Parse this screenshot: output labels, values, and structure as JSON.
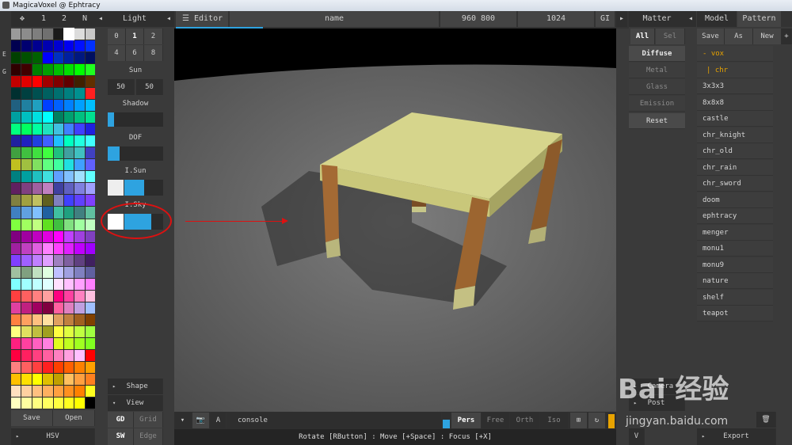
{
  "window": {
    "title": "MagicaVoxel @ Ephtracy"
  },
  "left_toolbar": {
    "tab1": "1",
    "tab2": "2",
    "tab3": "N"
  },
  "side_letters": [
    "E",
    "G"
  ],
  "palette": {
    "colors": [
      "#9a9a9a",
      "#8c8c8c",
      "#7e7e7e",
      "#707070",
      "#1a1a1a",
      "#ffffff",
      "#dcdcdc",
      "#c8c8c8",
      "#000050",
      "#000070",
      "#000090",
      "#0000b0",
      "#0000d0",
      "#0000f0",
      "#0010ff",
      "#0030ff",
      "#004000",
      "#005000",
      "#006000",
      "#0000ff",
      "#0030c0",
      "#0020a0",
      "#001880",
      "#001060",
      "#300000",
      "#400000",
      "#008000",
      "#00a000",
      "#00c000",
      "#00e000",
      "#00ff00",
      "#20ff20",
      "#c00000",
      "#e00000",
      "#ff0000",
      "#a00000",
      "#800000",
      "#600000",
      "#402000",
      "#603000",
      "#003030",
      "#004040",
      "#005050",
      "#006060",
      "#007070",
      "#008080",
      "#009090",
      "#ff2020",
      "#206080",
      "#2080a0",
      "#20a0c0",
      "#0040ff",
      "#0060ff",
      "#0080ff",
      "#00a0ff",
      "#00c0ff",
      "#00a0a0",
      "#00c0c0",
      "#00e0e0",
      "#00ffff",
      "#008060",
      "#00a070",
      "#00c080",
      "#00e090",
      "#00ff80",
      "#00ff60",
      "#00ffa0",
      "#20e0c0",
      "#40c0e0",
      "#4080ff",
      "#4040ff",
      "#2020e0",
      "#2020a0",
      "#2020c0",
      "#2040e0",
      "#4060ff",
      "#20c0ff",
      "#00ffc0",
      "#20ffe0",
      "#40ffff",
      "#40a040",
      "#40c040",
      "#40e040",
      "#40ff40",
      "#20c080",
      "#40a0a0",
      "#40c0c0",
      "#4040c0",
      "#c0c020",
      "#a0c040",
      "#80e060",
      "#60ff80",
      "#40ffa0",
      "#20e0e0",
      "#40a0ff",
      "#6060ff",
      "#008080",
      "#00a0a0",
      "#20c0c0",
      "#40e0e0",
      "#60a0ff",
      "#80c0ff",
      "#a0e0ff",
      "#60ffff",
      "#602060",
      "#804080",
      "#a060a0",
      "#c080c0",
      "#4040a0",
      "#6060c0",
      "#8080e0",
      "#a0a0ff",
      "#808040",
      "#a0a040",
      "#c0c060",
      "#606020",
      "#8080c0",
      "#4040ff",
      "#6040ff",
      "#8040ff",
      "#4080c0",
      "#60a0e0",
      "#80c0ff",
      "#2060a0",
      "#40c0a0",
      "#20a080",
      "#408080",
      "#60c0a0",
      "#80ff40",
      "#a0ff60",
      "#c0ff80",
      "#60e020",
      "#40c040",
      "#80e080",
      "#a0ffa0",
      "#c0ffc0",
      "#800080",
      "#a000a0",
      "#c000c0",
      "#e000e0",
      "#ff00ff",
      "#c040ff",
      "#a040e0",
      "#8040c0",
      "#a020a0",
      "#c040c0",
      "#e060e0",
      "#ff80ff",
      "#ff40ff",
      "#e020ff",
      "#c000ff",
      "#a000ff",
      "#8040ff",
      "#a060ff",
      "#c080ff",
      "#e0a0ff",
      "#a080c0",
      "#8060a0",
      "#604080",
      "#402060",
      "#a0c0a0",
      "#80a080",
      "#c0e0c0",
      "#e0ffe0",
      "#c0c0ff",
      "#a0a0e0",
      "#8080c0",
      "#6060a0",
      "#80ffff",
      "#a0ffff",
      "#c0ffff",
      "#e0ffff",
      "#ffe0ff",
      "#ffc0ff",
      "#ffa0ff",
      "#ff80ff",
      "#ff4040",
      "#ff6060",
      "#ff8080",
      "#ffa0a0",
      "#ff0080",
      "#ff40a0",
      "#ff80c0",
      "#ffc0e0",
      "#e040a0",
      "#c02080",
      "#a00060",
      "#800040",
      "#ff60a0",
      "#e080c0",
      "#c0a0e0",
      "#a0c0ff",
      "#ff8040",
      "#ffa060",
      "#ffc080",
      "#ffe0a0",
      "#e0a060",
      "#c08040",
      "#a06020",
      "#804000",
      "#ffff80",
      "#e0e060",
      "#c0c040",
      "#a0a020",
      "#ffff40",
      "#e0ff40",
      "#c0ff40",
      "#a0ff40",
      "#ff2080",
      "#ff40a0",
      "#ff60c0",
      "#ff80e0",
      "#e0ff20",
      "#c0ff20",
      "#a0ff20",
      "#80ff20",
      "#ff0040",
      "#ff2060",
      "#ff4080",
      "#ff60a0",
      "#ff80c0",
      "#ffa0e0",
      "#ffc0ff",
      "#ff0000",
      "#ff8080",
      "#ff6060",
      "#ff4040",
      "#ff2020",
      "#ff4000",
      "#ff6000",
      "#ff8000",
      "#ffa000",
      "#ffc000",
      "#ffe000",
      "#ffff00",
      "#e0c000",
      "#c0a000",
      "#ffc060",
      "#ffa040",
      "#ff8020",
      "#ffe0c0",
      "#ffd0a0",
      "#ffc080",
      "#ffb060",
      "#ffa040",
      "#ff9020",
      "#ff8000",
      "#ffff20",
      "#ffffc0",
      "#ffffa0",
      "#ffff80",
      "#ffff60",
      "#ffff40",
      "#ffff20",
      "#ffff00",
      "#000000"
    ],
    "save": "Save",
    "open": "Open",
    "mode": "HSV"
  },
  "light": {
    "title": "Light",
    "row1": [
      "0",
      "1",
      "2"
    ],
    "row2": [
      "4",
      "6",
      "8"
    ],
    "sun_label": "Sun",
    "sun_values": [
      "50",
      "50"
    ],
    "shadow_label": "Shadow",
    "shadow_level": 0.12,
    "dof_label": "DOF",
    "dof_level": 0.22,
    "isun_label": "I.Sun",
    "isun_level": 0.5,
    "isky_label": "I.Sky",
    "isky_level": 0.7,
    "shape_label": "Shape",
    "view_label": "View",
    "gd": "GD",
    "grid": "Grid",
    "sw": "SW",
    "edge": "Edge"
  },
  "editor": {
    "tab": "Editor",
    "name": "name",
    "size": "960 800",
    "samples": "1024",
    "gi": "GI",
    "console": "console",
    "a_label": "A",
    "modes": [
      "Pers",
      "Free",
      "Orth",
      "Iso"
    ],
    "status": "Rotate [RButton] : Move [+Space] : Focus [+X]"
  },
  "matter": {
    "title": "Matter",
    "all": "All",
    "sel": "Sel",
    "items": [
      "Diffuse",
      "Metal",
      "Glass",
      "Emission"
    ],
    "reset": "Reset",
    "camera": "Camera",
    "post": "Post",
    "v": "V"
  },
  "pattern": {
    "model_tab": "Model",
    "pattern_tab": "Pattern",
    "save": "Save",
    "as": "As",
    "new": "New",
    "plus": "+",
    "items": [
      "- vox",
      "| chr",
      "3x3x3",
      "8x8x8",
      "castle",
      "chr_knight",
      "chr_old",
      "chr_rain",
      "chr_sword",
      "doom",
      "ephtracy",
      "menger",
      "monu1",
      "monu9",
      "nature",
      "shelf",
      "teapot"
    ],
    "export": "Export"
  },
  "watermark": {
    "brand": "Bai 经验",
    "url": "jingyan.baidu.com"
  },
  "colors": {
    "accent": "#2ea3e0",
    "highlight": "#e8a300",
    "annotation": "#dd1111"
  }
}
